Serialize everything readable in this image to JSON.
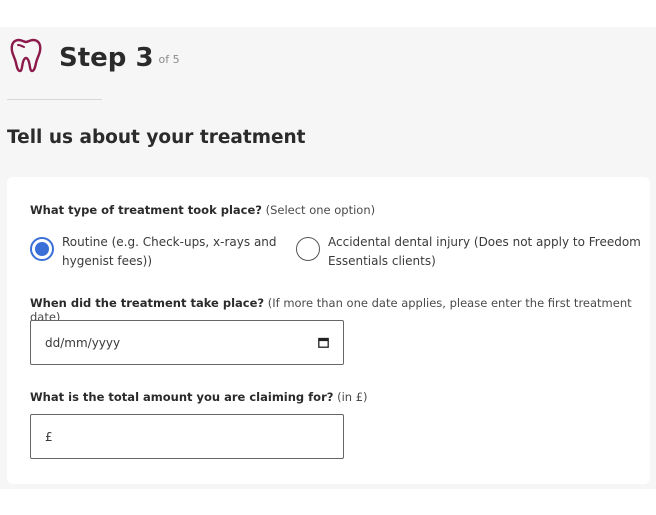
{
  "header": {
    "step_label": "Step 3",
    "step_of": "of 5",
    "icon": "tooth-icon",
    "accent_color": "#8b1a4a"
  },
  "section": {
    "heading": "Tell us about your treatment"
  },
  "treatment_type": {
    "question": "What type of treatment took place?",
    "hint": "(Select one option)",
    "options": [
      {
        "line1": "Routine (e.g. Check-ups, x-rays and",
        "line2": "hygenist fees))",
        "selected": true
      },
      {
        "line1": "Accidental dental injury (Does not apply to Freedom",
        "line2": "Essentials clients)",
        "selected": false
      }
    ]
  },
  "treatment_date": {
    "question": "When did the treatment take place?",
    "hint": "(If more than one date applies, please enter the first treatment date)",
    "placeholder": "dd/mm/yyyy",
    "icon": "calendar-icon"
  },
  "amount": {
    "question": "What is the total amount you are claiming for?",
    "hint": "(in £)",
    "value": "£"
  },
  "colors": {
    "radio_selected": "#3a6fd8",
    "card_background": "#ffffff",
    "page_background": "#f6f6f6"
  }
}
